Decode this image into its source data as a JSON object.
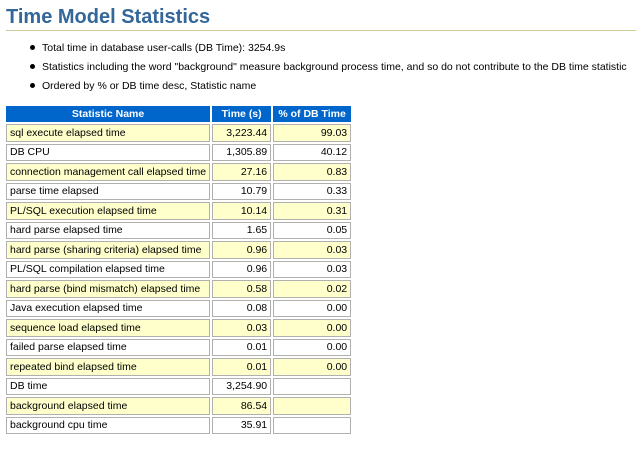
{
  "page": {
    "title": "Time Model Statistics",
    "notes": [
      "Total time in database user-calls (DB Time): 3254.9s",
      "Statistics including the word \"background\" measure background process time, and so do not contribute to the DB time statistic",
      "Ordered by % or DB time desc, Statistic name"
    ]
  },
  "table": {
    "headers": [
      "Statistic Name",
      "Time (s)",
      "% of DB Time"
    ],
    "rows": [
      {
        "name": "sql execute elapsed time",
        "time": "3,223.44",
        "pct": "99.03"
      },
      {
        "name": "DB CPU",
        "time": "1,305.89",
        "pct": "40.12"
      },
      {
        "name": "connection management call elapsed time",
        "time": "27.16",
        "pct": "0.83"
      },
      {
        "name": "parse time elapsed",
        "time": "10.79",
        "pct": "0.33"
      },
      {
        "name": "PL/SQL execution elapsed time",
        "time": "10.14",
        "pct": "0.31"
      },
      {
        "name": "hard parse elapsed time",
        "time": "1.65",
        "pct": "0.05"
      },
      {
        "name": "hard parse (sharing criteria) elapsed time",
        "time": "0.96",
        "pct": "0.03"
      },
      {
        "name": "PL/SQL compilation elapsed time",
        "time": "0.96",
        "pct": "0.03"
      },
      {
        "name": "hard parse (bind mismatch) elapsed time",
        "time": "0.58",
        "pct": "0.02"
      },
      {
        "name": "Java execution elapsed time",
        "time": "0.08",
        "pct": "0.00"
      },
      {
        "name": "sequence load elapsed time",
        "time": "0.03",
        "pct": "0.00"
      },
      {
        "name": "failed parse elapsed time",
        "time": "0.01",
        "pct": "0.00"
      },
      {
        "name": "repeated bind elapsed time",
        "time": "0.01",
        "pct": "0.00"
      },
      {
        "name": "DB time",
        "time": "3,254.90",
        "pct": ""
      },
      {
        "name": "background elapsed time",
        "time": "86.54",
        "pct": ""
      },
      {
        "name": "background cpu time",
        "time": "35.91",
        "pct": ""
      }
    ]
  },
  "colors": {
    "title": "#336699",
    "header_bg": "#0066cc",
    "header_fg": "#ffffff",
    "row_alt": "#ffffcc",
    "row_plain": "#ffffff"
  }
}
